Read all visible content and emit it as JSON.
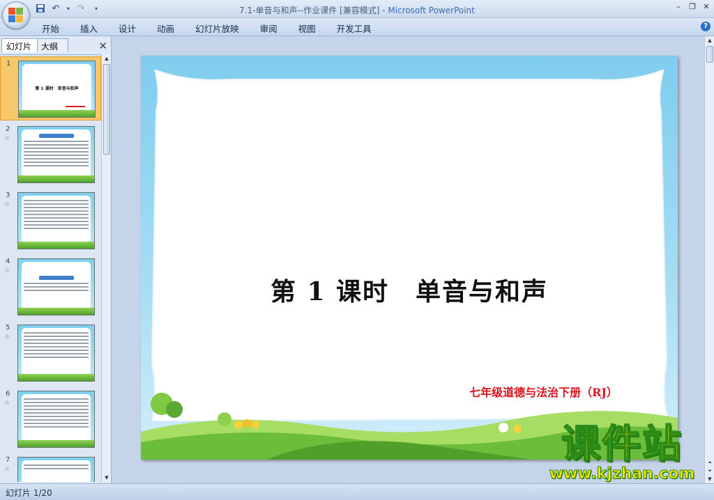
{
  "window": {
    "title": "7.1-单音与和声--作业课件 [兼容模式] - ",
    "app_name": "Microsoft PowerPoint"
  },
  "ribbon": {
    "tabs": [
      "开始",
      "插入",
      "设计",
      "动画",
      "幻灯片放映",
      "审阅",
      "视图",
      "开发工具"
    ]
  },
  "left_panel": {
    "tab_slides": "幻灯片",
    "tab_outline": "大纲",
    "thumbnails": [
      {
        "num": "1",
        "star": "",
        "title": "第 1 课时　单音与和声"
      },
      {
        "num": "2",
        "star": "☆"
      },
      {
        "num": "3",
        "star": "☆"
      },
      {
        "num": "4",
        "star": "☆"
      },
      {
        "num": "5",
        "star": "☆"
      },
      {
        "num": "6",
        "star": "☆"
      },
      {
        "num": "7",
        "star": "☆"
      }
    ]
  },
  "slide": {
    "title": "第 1 课时　单音与和声",
    "subtitle": "七年级道德与法治下册（RJ）"
  },
  "status": {
    "slide_counter": "幻灯片 1/20"
  },
  "watermark": {
    "brand": "课件站",
    "url": "www.kjzhan.com"
  },
  "colors": {
    "subtitle": "#d8141c",
    "selected_thumb": "#f7c86a"
  }
}
